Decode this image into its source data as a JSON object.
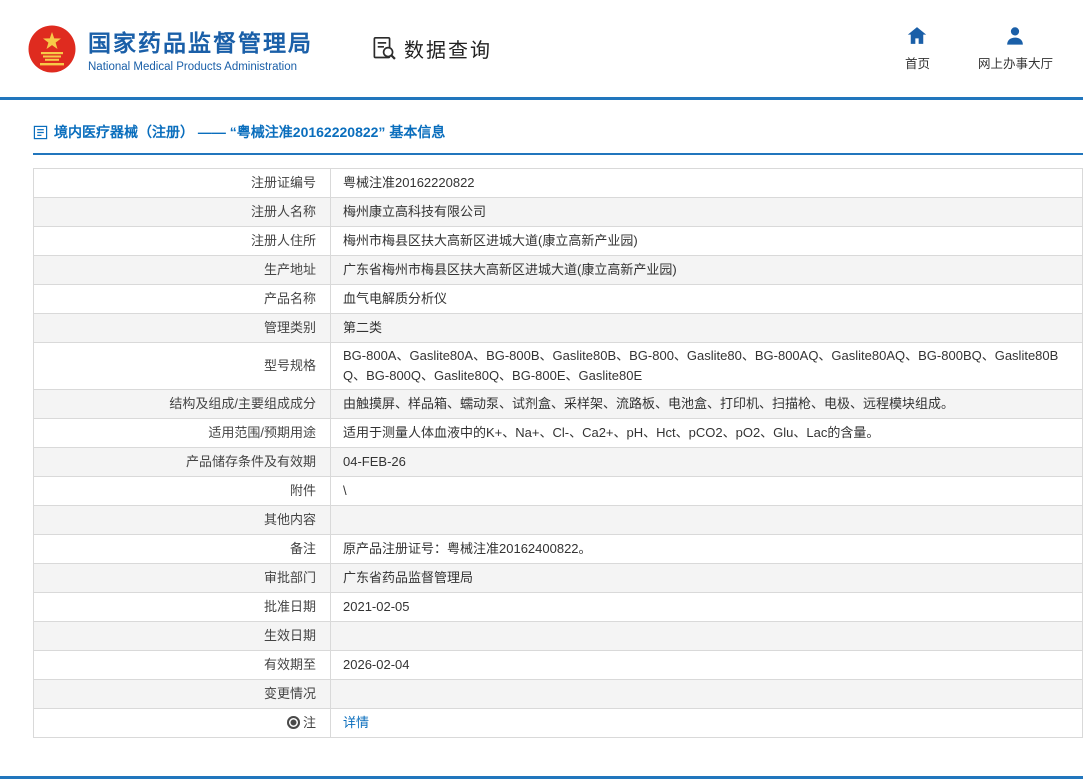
{
  "colors": {
    "brand_blue": "#1a5fa8",
    "accent_blue": "#2176bd",
    "link_blue": "#0a6ebd",
    "emblem_red": "#df2b1f",
    "row_alt": "#f4f4f4",
    "border": "#d9d9d9"
  },
  "header": {
    "logo": {
      "org_name_cn": "国家药品监督管理局",
      "org_name_en": "National Medical Products Administration"
    },
    "section_title": "数据查询",
    "nav": [
      {
        "label": "首页",
        "icon": "home-icon"
      },
      {
        "label": "网上办事大厅",
        "icon": "user-icon"
      }
    ]
  },
  "page": {
    "breadcrumb": "境内医疗器械（注册） —— “粤械注准20162220822” 基本信息"
  },
  "table": {
    "rows": [
      {
        "label": "注册证编号",
        "value": "粤械注准20162220822"
      },
      {
        "label": "注册人名称",
        "value": "梅州康立高科技有限公司"
      },
      {
        "label": "注册人住所",
        "value": "梅州市梅县区扶大高新区进城大道(康立高新产业园)"
      },
      {
        "label": "生产地址",
        "value": "广东省梅州市梅县区扶大高新区进城大道(康立高新产业园)"
      },
      {
        "label": "产品名称",
        "value": "血气电解质分析仪"
      },
      {
        "label": "管理类别",
        "value": "第二类"
      },
      {
        "label": "型号规格",
        "value": "BG-800A、Gaslite80A、BG-800B、Gaslite80B、BG-800、Gaslite80、BG-800AQ、Gaslite80AQ、BG-800BQ、Gaslite80BQ、BG-800Q、Gaslite80Q、BG-800E、Gaslite80E"
      },
      {
        "label": "结构及组成/主要组成成分",
        "value": "由触摸屏、样品箱、蠕动泵、试剂盒、采样架、流路板、电池盒、打印机、扫描枪、电极、远程模块组成。"
      },
      {
        "label": "适用范围/预期用途",
        "value": "适用于测量人体血液中的K+、Na+、Cl-、Ca2+、pH、Hct、pCO2、pO2、Glu、Lac的含量。"
      },
      {
        "label": "产品储存条件及有效期",
        "value": "04-FEB-26"
      },
      {
        "label": "附件",
        "value": "\\"
      },
      {
        "label": "其他内容",
        "value": ""
      },
      {
        "label": "备注",
        "value": "原产品注册证号：粤械注准20162400822。"
      },
      {
        "label": "审批部门",
        "value": "广东省药品监督管理局"
      },
      {
        "label": "批准日期",
        "value": "2021-02-05"
      },
      {
        "label": "生效日期",
        "value": ""
      },
      {
        "label": "有效期至",
        "value": "2026-02-04"
      },
      {
        "label": "变更情况",
        "value": ""
      },
      {
        "label": "注",
        "value": "详情",
        "link": true,
        "label_icon": "note-icon"
      }
    ]
  }
}
